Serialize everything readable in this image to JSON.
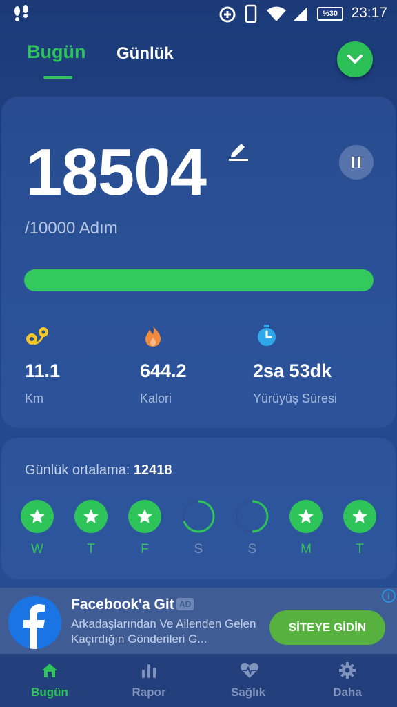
{
  "status_bar": {
    "time": "23:17",
    "battery": "%30",
    "icons": [
      "footsteps-icon",
      "data-saver-icon",
      "phone-icon",
      "wifi-icon",
      "signal-icon",
      "battery-icon"
    ]
  },
  "header": {
    "tabs": [
      {
        "label": "Bugün",
        "active": true
      },
      {
        "label": "Günlük",
        "active": false
      }
    ],
    "dropdown_icon": "chevron-down-icon"
  },
  "steps_card": {
    "steps": "18504",
    "goal_text": "/10000 Adım",
    "progress_fraction": 1.0,
    "stats": [
      {
        "value": "11.1",
        "label": "Km",
        "icon": "distance-icon",
        "color": "#f3c623"
      },
      {
        "value": "644.2",
        "label": "Kalori",
        "icon": "flame-icon",
        "color": "#f08a3e"
      },
      {
        "value": "2sa 53dk",
        "label": "Yürüyüş Süresi",
        "icon": "stopwatch-icon",
        "color": "#2fa8ea"
      }
    ]
  },
  "average_card": {
    "label": "Günlük ortalama:",
    "value": "12418",
    "days": [
      {
        "letter": "W",
        "status": "done"
      },
      {
        "letter": "T",
        "status": "done"
      },
      {
        "letter": "F",
        "status": "done"
      },
      {
        "letter": "S",
        "status": "partial",
        "fraction": 0.7
      },
      {
        "letter": "S",
        "status": "partial",
        "fraction": 0.5
      },
      {
        "letter": "M",
        "status": "done"
      },
      {
        "letter": "T",
        "status": "done"
      }
    ]
  },
  "ad": {
    "title": "Facebook'a Git",
    "badge": "AD",
    "description": "Arkadaşlarından Ve Ailenden Gelen Kaçırdığın Gönderileri G...",
    "cta": "SİTEYE GİDİN",
    "info": "i"
  },
  "bottom_nav": [
    {
      "label": "Bugün",
      "icon": "home-icon",
      "active": true
    },
    {
      "label": "Rapor",
      "icon": "bar-chart-icon",
      "active": false
    },
    {
      "label": "Sağlık",
      "icon": "heart-pulse-icon",
      "active": false
    },
    {
      "label": "Daha",
      "icon": "gear-icon",
      "active": false
    }
  ]
}
